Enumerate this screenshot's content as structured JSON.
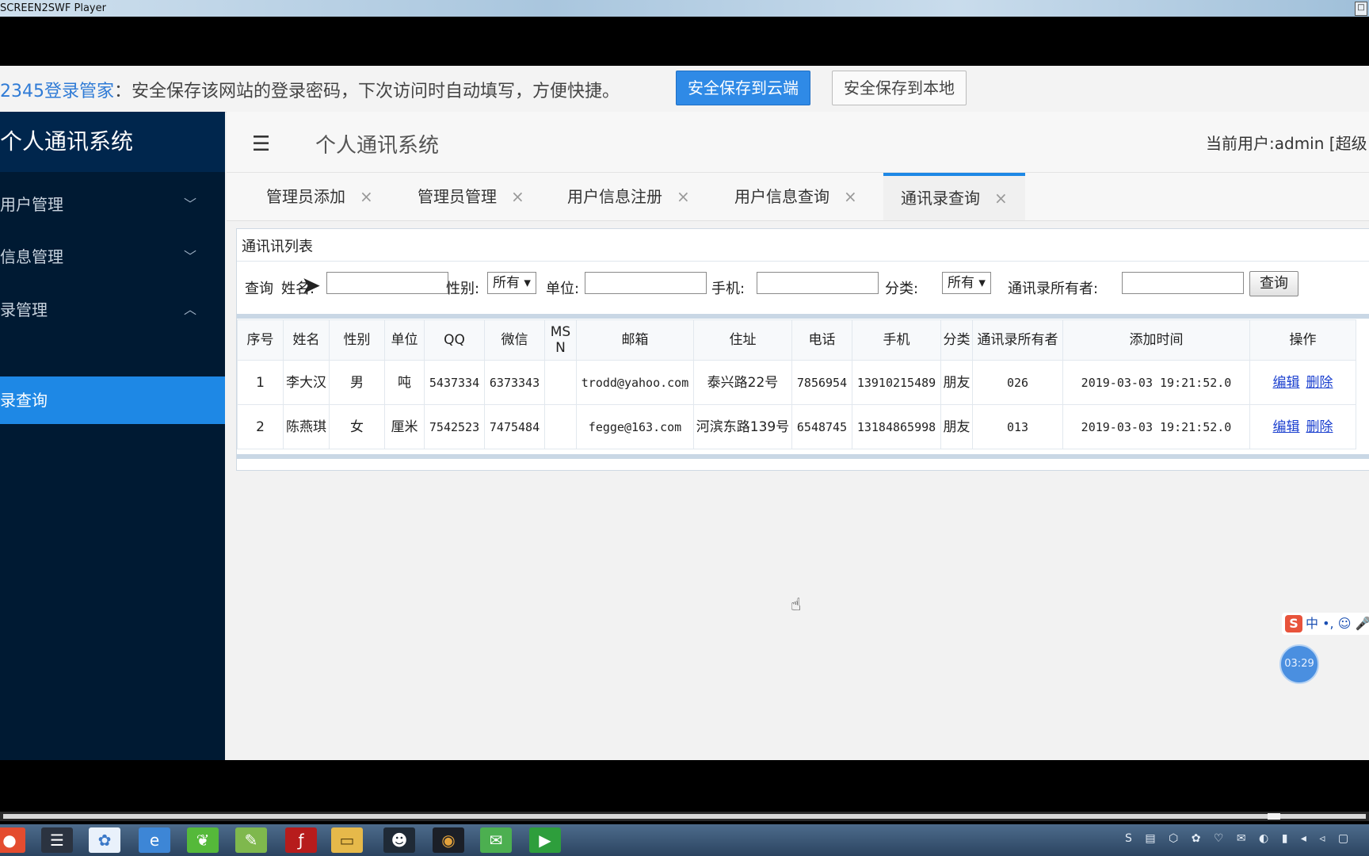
{
  "window": {
    "title": "SCREEN2SWF Player",
    "control": "□"
  },
  "password_bar": {
    "brand": "2345登录管家",
    "message": "：安全保存该网站的登录密码，下次访问时自动填写，方便快捷。",
    "save_cloud": "安全保存到云端",
    "save_local": "安全保存到本地"
  },
  "sidebar": {
    "brand": "个人通讯系统",
    "menus": [
      {
        "label": "用户管理",
        "chevron": "﹀"
      },
      {
        "label": "信息管理",
        "chevron": "﹀"
      },
      {
        "label": "录管理",
        "chevron": "︿"
      }
    ],
    "active_item": "录查询"
  },
  "header": {
    "menu_icon": "☰",
    "title": "个人通讯系统",
    "current_user": "当前用户:admin [超级"
  },
  "tabs": [
    {
      "label": "管理员添加",
      "close": "×"
    },
    {
      "label": "管理员管理",
      "close": "×"
    },
    {
      "label": "用户信息注册",
      "close": "×"
    },
    {
      "label": "用户信息查询",
      "close": "×"
    },
    {
      "label": "通讯录查询",
      "close": "×"
    }
  ],
  "panel": {
    "title": "通讯讯列表",
    "query": {
      "query_label": "查询",
      "name_label": "姓名:",
      "name_value": "",
      "gender_label": "性别:",
      "gender_value": "所有 ▾",
      "unit_label": "单位:",
      "unit_value": "",
      "mobile_label": "手机:",
      "mobile_value": "",
      "category_label": "分类:",
      "category_value": "所有 ▾",
      "owner_label": "通讯录所有者:",
      "owner_value": "",
      "search_button": "查询"
    },
    "columns": [
      "序号",
      "姓名",
      "性别",
      "单位",
      "QQ",
      "微信",
      "MSN",
      "邮箱",
      "住址",
      "电话",
      "手机",
      "分类",
      "通讯录所有者",
      "添加时间",
      "操作"
    ],
    "rows": [
      {
        "no": "1",
        "name": "李大汉",
        "gender": "男",
        "unit": "吨",
        "qq": "5437334",
        "wechat": "6373343",
        "msn": "",
        "email": "trodd@yahoo.com",
        "address": "泰兴路22号",
        "phone": "7856954",
        "mobile": "13910215489",
        "category": "朋友",
        "owner": "026",
        "added": "2019-03-03 19:21:52.0",
        "edit": "编辑",
        "delete": "删除"
      },
      {
        "no": "2",
        "name": "陈燕琪",
        "gender": "女",
        "unit": "厘米",
        "qq": "7542523",
        "wechat": "7475484",
        "msn": "",
        "email": "fegge@163.com",
        "address": "河滨东路139号",
        "phone": "6548745",
        "mobile": "13184865998",
        "category": "朋友",
        "owner": "013",
        "added": "2019-03-03 19:21:52.0",
        "edit": "编辑",
        "delete": "删除"
      }
    ]
  },
  "ime": {
    "logo": "S",
    "status": "中 •, ☺ 🎤"
  },
  "timer": "03:29",
  "taskbar": {
    "icons": [
      "chrome-icon",
      "app-icon",
      "network-icon",
      "browser-icon",
      "leaf-icon",
      "notepad-icon",
      "flash-icon",
      "folder-icon",
      "qq-icon",
      "media-icon",
      "wechat-icon",
      "recorder-icon"
    ],
    "tray": "S ▤ ⬡ ✿ ♡ ✉ ◐ ▮ ◂ ◃ ▢"
  }
}
